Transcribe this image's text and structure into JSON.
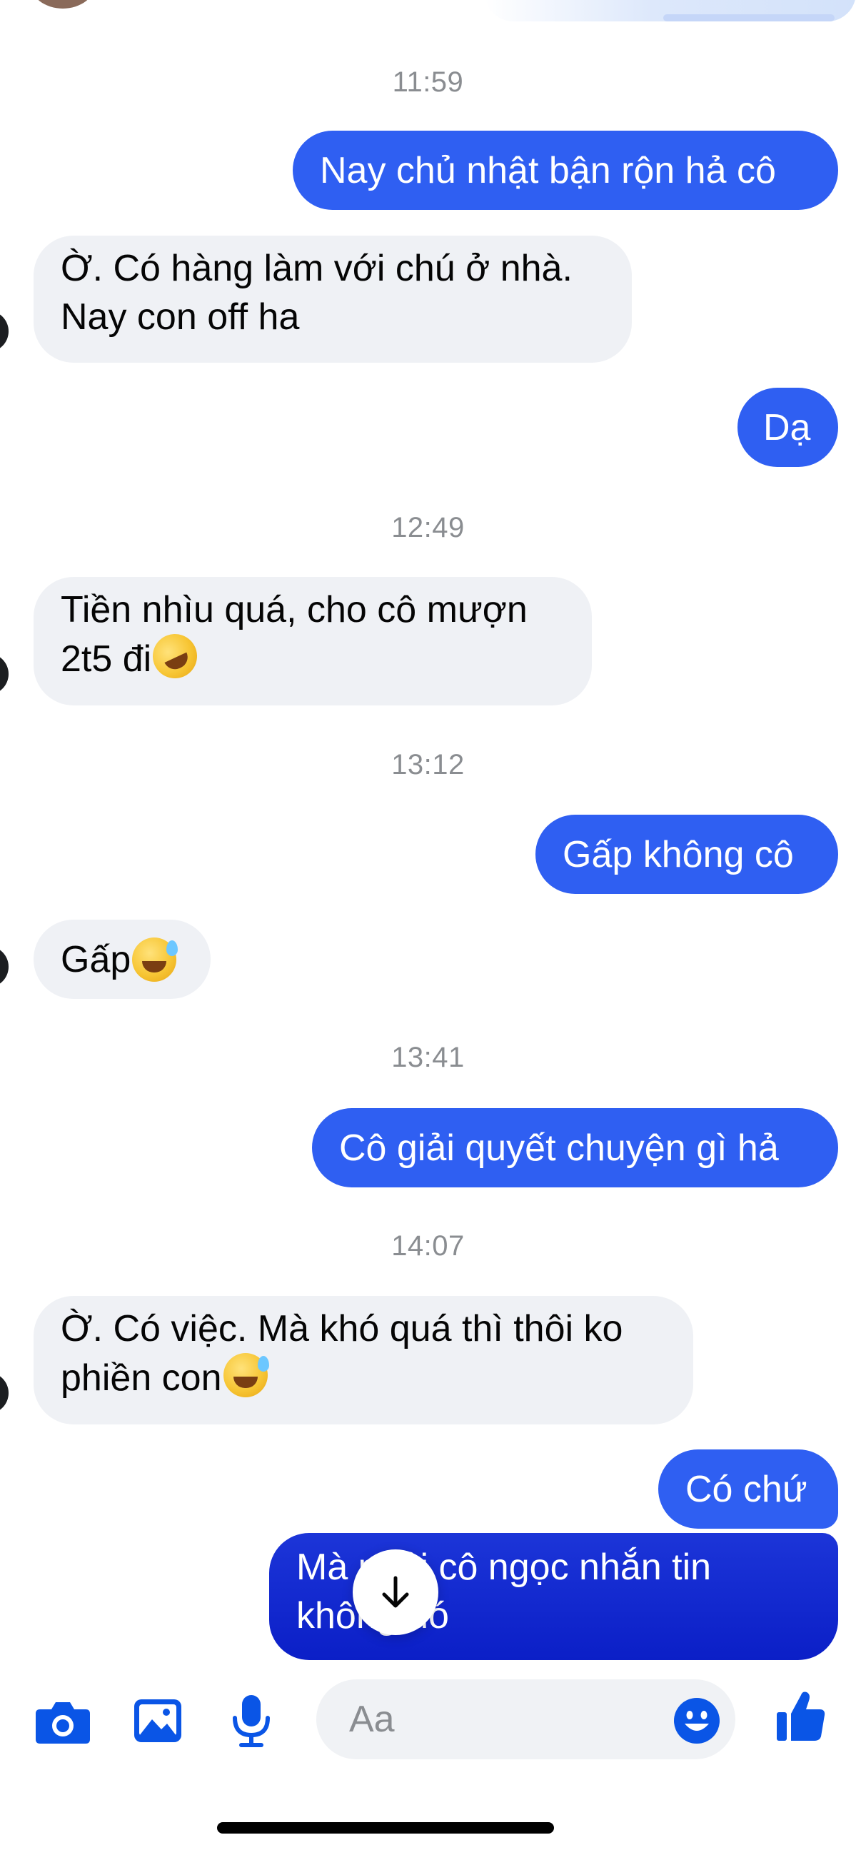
{
  "theme": {
    "outgoing_bubble": "#2f5ff2",
    "outgoing_latest_bubble": "#0b1fc7",
    "incoming_bubble": "#eff1f5",
    "timestamp_text": "#8a8d91",
    "composer_icon": "#0a55e6"
  },
  "conversation": {
    "timestamps": [
      "11:59",
      "12:49",
      "13:12",
      "13:41",
      "14:07"
    ],
    "messages": [
      {
        "direction": "outgoing",
        "lines": [
          "Nay chủ nhật bận rộn hả cô"
        ]
      },
      {
        "direction": "incoming",
        "lines": [
          "Ờ. Có hàng làm với chú ở nhà.",
          "Nay con off ha"
        ]
      },
      {
        "direction": "outgoing",
        "lines": [
          "Dạ"
        ]
      },
      {
        "direction": "incoming",
        "lines": [
          "Tiền nhìu quá, cho cô mượn",
          "2t5 đi"
        ],
        "emoji": "rolling-on-floor-laughing"
      },
      {
        "direction": "outgoing",
        "lines": [
          "Gấp không cô"
        ]
      },
      {
        "direction": "incoming",
        "lines": [
          "Gấp"
        ],
        "emoji": "grinning-sweat"
      },
      {
        "direction": "outgoing",
        "lines": [
          "Cô giải quyết chuyện gì hả"
        ]
      },
      {
        "direction": "incoming",
        "lines": [
          "Ờ. Có việc. Mà khó quá thì thôi ko",
          "phiền con"
        ],
        "emoji": "grinning-sweat"
      },
      {
        "direction": "outgoing",
        "lines": [
          "Có chứ"
        ]
      },
      {
        "direction": "outgoing",
        "lines": [
          "Mà phải cô ngọc nhắn tin",
          "không đó"
        ]
      }
    ]
  },
  "composer": {
    "placeholder": "Aa",
    "icons": [
      "camera-icon",
      "gallery-icon",
      "microphone-icon",
      "emoji-icon",
      "thumbs-up-icon"
    ]
  },
  "scroll_button": {
    "icon": "arrow-down-icon"
  }
}
